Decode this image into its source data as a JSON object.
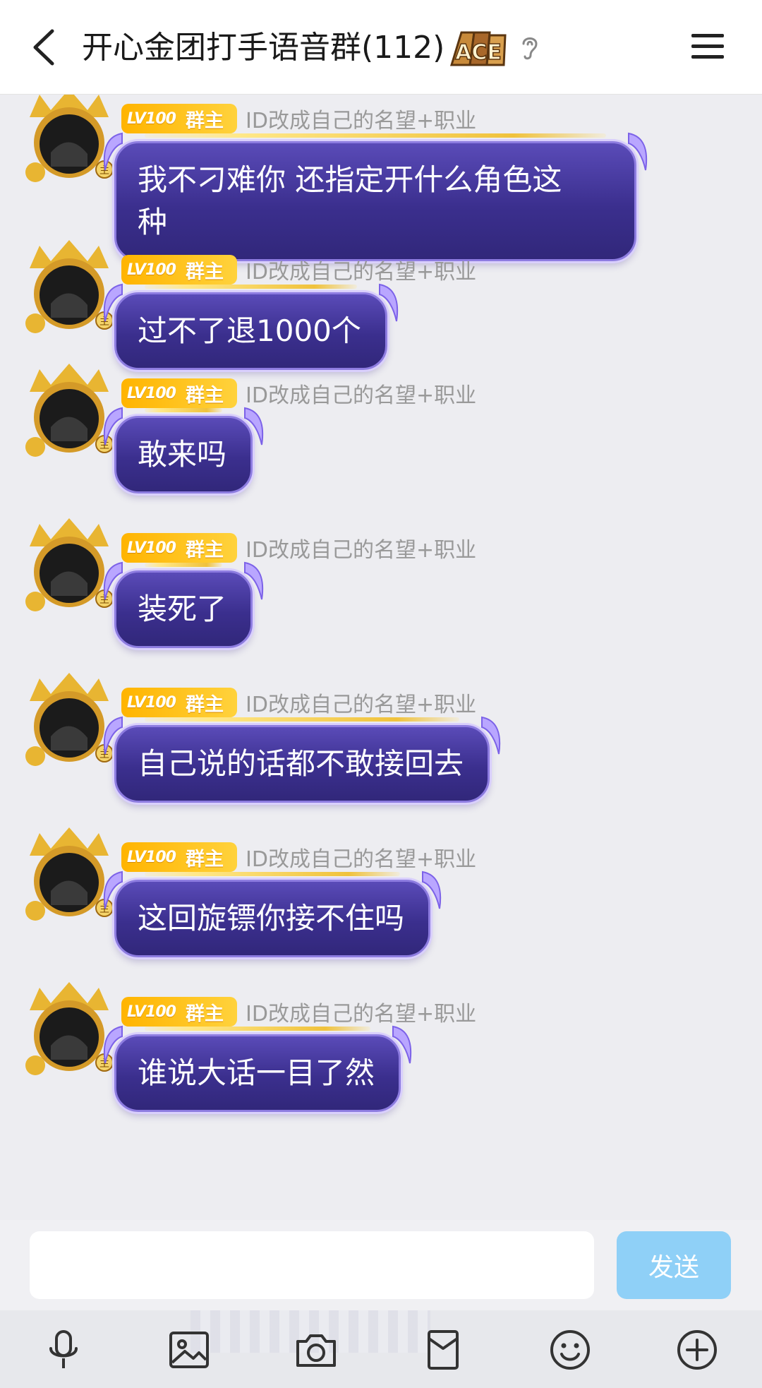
{
  "header": {
    "title": "开心金团打手语音群(112)",
    "badge_text": "ACE"
  },
  "input": {
    "placeholder": "",
    "send_label": "发送"
  },
  "messages": [
    {
      "level": "LV100",
      "role": "群主",
      "name": "ID改成自己的名望+职业",
      "lines": [
        "我不刁难你 还指定开什么角色这",
        "种"
      ]
    },
    {
      "level": "LV100",
      "role": "群主",
      "name": "ID改成自己的名望+职业",
      "lines": [
        "过不了退1000个"
      ]
    },
    {
      "level": "LV100",
      "role": "群主",
      "name": "ID改成自己的名望+职业",
      "lines": [
        "敢来吗"
      ]
    },
    {
      "level": "LV100",
      "role": "群主",
      "name": "ID改成自己的名望+职业",
      "lines": [
        "装死了"
      ]
    },
    {
      "level": "LV100",
      "role": "群主",
      "name": "ID改成自己的名望+职业",
      "lines": [
        "自己说的话都不敢接回去"
      ]
    },
    {
      "level": "LV100",
      "role": "群主",
      "name": "ID改成自己的名望+职业",
      "lines": [
        "这回旋镖你接不住吗"
      ]
    },
    {
      "level": "LV100",
      "role": "群主",
      "name": "ID改成自己的名望+职业",
      "lines": [
        "谁说大话一目了然"
      ]
    }
  ],
  "toolbar": {
    "icons": [
      "microphone-icon",
      "image-icon",
      "camera-icon",
      "envelope-icon",
      "emoji-icon",
      "plus-circle-icon"
    ]
  },
  "colors": {
    "bubble": "#3b2f8e",
    "send_button": "#8fd0f7",
    "level_badge": "#ffc21a"
  }
}
